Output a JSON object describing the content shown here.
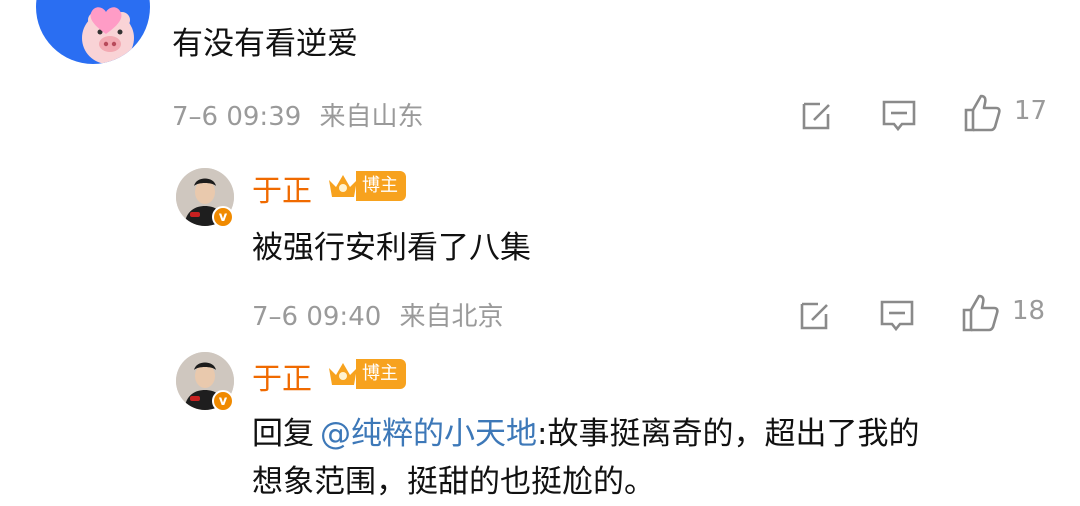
{
  "comments": [
    {
      "text": "有没有看逆爱",
      "time": "7–6 09:39",
      "location": "来自山东",
      "likes": "17"
    },
    {
      "author": "于正",
      "badge": "博主",
      "verified_mark": "v",
      "text": "被强行安利看了八集",
      "time": "7–6 09:40",
      "location": "来自北京",
      "likes": "18"
    },
    {
      "author": "于正",
      "badge": "博主",
      "verified_mark": "v",
      "reply_prefix": "回复",
      "mention": "@纯粹的小天地",
      "text_line1": ":故事挺离奇的，超出了我的",
      "text_line2": "想象范围，挺甜的也挺尬的。"
    }
  ],
  "colors": {
    "author_name": "#f06a00",
    "mention": "#3d78b8",
    "meta": "#9a9a9a",
    "avatar_blue": "#2a6ef2"
  }
}
